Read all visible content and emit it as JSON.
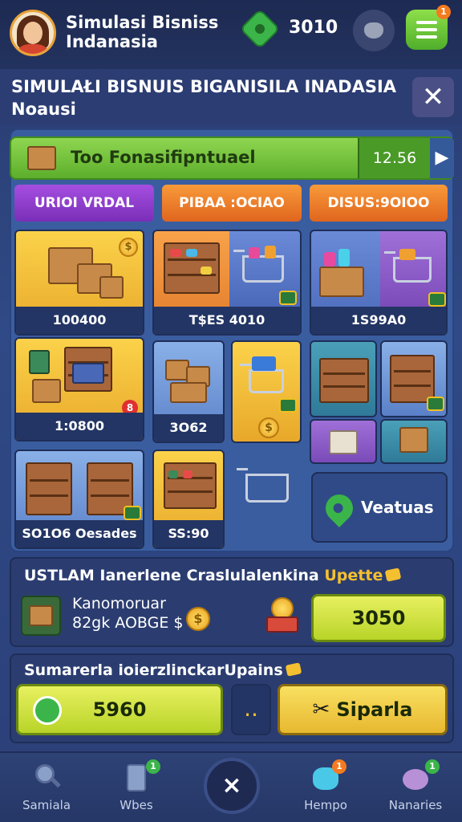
{
  "topbar": {
    "app_title": "Simulasi Bisniss Indanasia",
    "coin_count": "3010",
    "menu_badge": "1"
  },
  "header": {
    "title": "SIMULAŁI BISNUIS BIGANISILA INADASIA Noausi",
    "close_label": "✕"
  },
  "promo": {
    "text": "Too Fonasifipntuael",
    "price": "12.56",
    "arrow": "▶"
  },
  "tabs": [
    {
      "label": "URIOI VRDAL"
    },
    {
      "label": "PIBAA :OCIAO"
    },
    {
      "label": "DISUS:9OIOO"
    }
  ],
  "cards": [
    {
      "caption": "100400"
    },
    {
      "caption": "T$ES 4010"
    },
    {
      "caption": "1S99A0"
    },
    {
      "caption": "1:0800"
    },
    {
      "caption": "3O62"
    },
    {
      "caption": "SO1O6 Oesades"
    },
    {
      "caption": "SS:90"
    }
  ],
  "featured": {
    "label": "Veatuas"
  },
  "section1": {
    "title": "USTLAM Ianerlene Craslulalenkina",
    "title_accent": "Upette",
    "item_name": "Kanomoruar",
    "item_value": "82gk AOBGE $",
    "coin_symbol": "$",
    "button": "3050"
  },
  "section2": {
    "title": "Sumarerla ioierzlinckarUpains",
    "button_left": "5960",
    "button_mid": "..",
    "button_right": "Siparla"
  },
  "nav": [
    {
      "label": "Samiala",
      "icon": "magnifier-icon"
    },
    {
      "label": "Wbes",
      "icon": "tablet-icon",
      "badge": "1"
    },
    {
      "label": "×",
      "icon": "close-icon"
    },
    {
      "label": "Hempo",
      "icon": "monster-icon",
      "badge": "1"
    },
    {
      "label": "Nanaries",
      "icon": "cloud-creature-icon",
      "badge": "1"
    }
  ],
  "colors": {
    "background": "#2f4a86",
    "accent_green": "#5cae2c",
    "accent_orange": "#e0651e",
    "accent_purple": "#7a2fb8",
    "accent_yellow": "#f5c030"
  }
}
